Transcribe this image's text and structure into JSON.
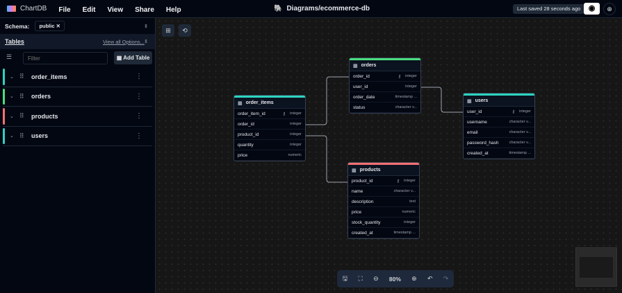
{
  "header": {
    "app_name": "ChartDB",
    "menu": [
      "File",
      "Edit",
      "View",
      "Share",
      "Help"
    ],
    "diagram_title": "Diagrams/ecommerce-db",
    "last_saved": "Last saved 28 seconds ago"
  },
  "sidebar": {
    "schema_label": "Schema:",
    "schema_value": "public",
    "tables_label": "Tables",
    "view_all": "View all Options...",
    "filter_placeholder": "Filter",
    "add_table": "Add Table",
    "items": [
      {
        "name": "order_items",
        "color": "#2dd4bf"
      },
      {
        "name": "orders",
        "color": "#4ade80"
      },
      {
        "name": "products",
        "color": "#f87171"
      },
      {
        "name": "users",
        "color": "#2dd4bf"
      }
    ]
  },
  "tables": [
    {
      "name": "order_items",
      "color": "#2dd4bf",
      "fields": [
        [
          "order_item_id",
          "integer",
          true
        ],
        [
          "order_id",
          "integer",
          false
        ],
        [
          "product_id",
          "integer",
          false
        ],
        [
          "quantity",
          "integer",
          false
        ],
        [
          "price",
          "numeric",
          false
        ]
      ]
    },
    {
      "name": "orders",
      "color": "#4ade80",
      "fields": [
        [
          "order_id",
          "integer",
          true
        ],
        [
          "user_id",
          "integer",
          false
        ],
        [
          "order_date",
          "timestamp ...",
          false
        ],
        [
          "status",
          "character v...",
          false
        ]
      ]
    },
    {
      "name": "users",
      "color": "#2dd4bf",
      "fields": [
        [
          "user_id",
          "integer",
          true
        ],
        [
          "username",
          "character v...",
          false
        ],
        [
          "email",
          "character v...",
          false
        ],
        [
          "password_hash",
          "character v...",
          false
        ],
        [
          "created_at",
          "timestamp ...",
          false
        ]
      ]
    },
    {
      "name": "products",
      "color": "#f87171",
      "fields": [
        [
          "product_id",
          "integer",
          true
        ],
        [
          "name",
          "character v...",
          false
        ],
        [
          "description",
          "text",
          false
        ],
        [
          "price",
          "numeric",
          false
        ],
        [
          "stock_quantity",
          "integer",
          false
        ],
        [
          "created_at",
          "timestamp ...",
          false
        ]
      ]
    }
  ],
  "zoom": {
    "level": "80%"
  }
}
